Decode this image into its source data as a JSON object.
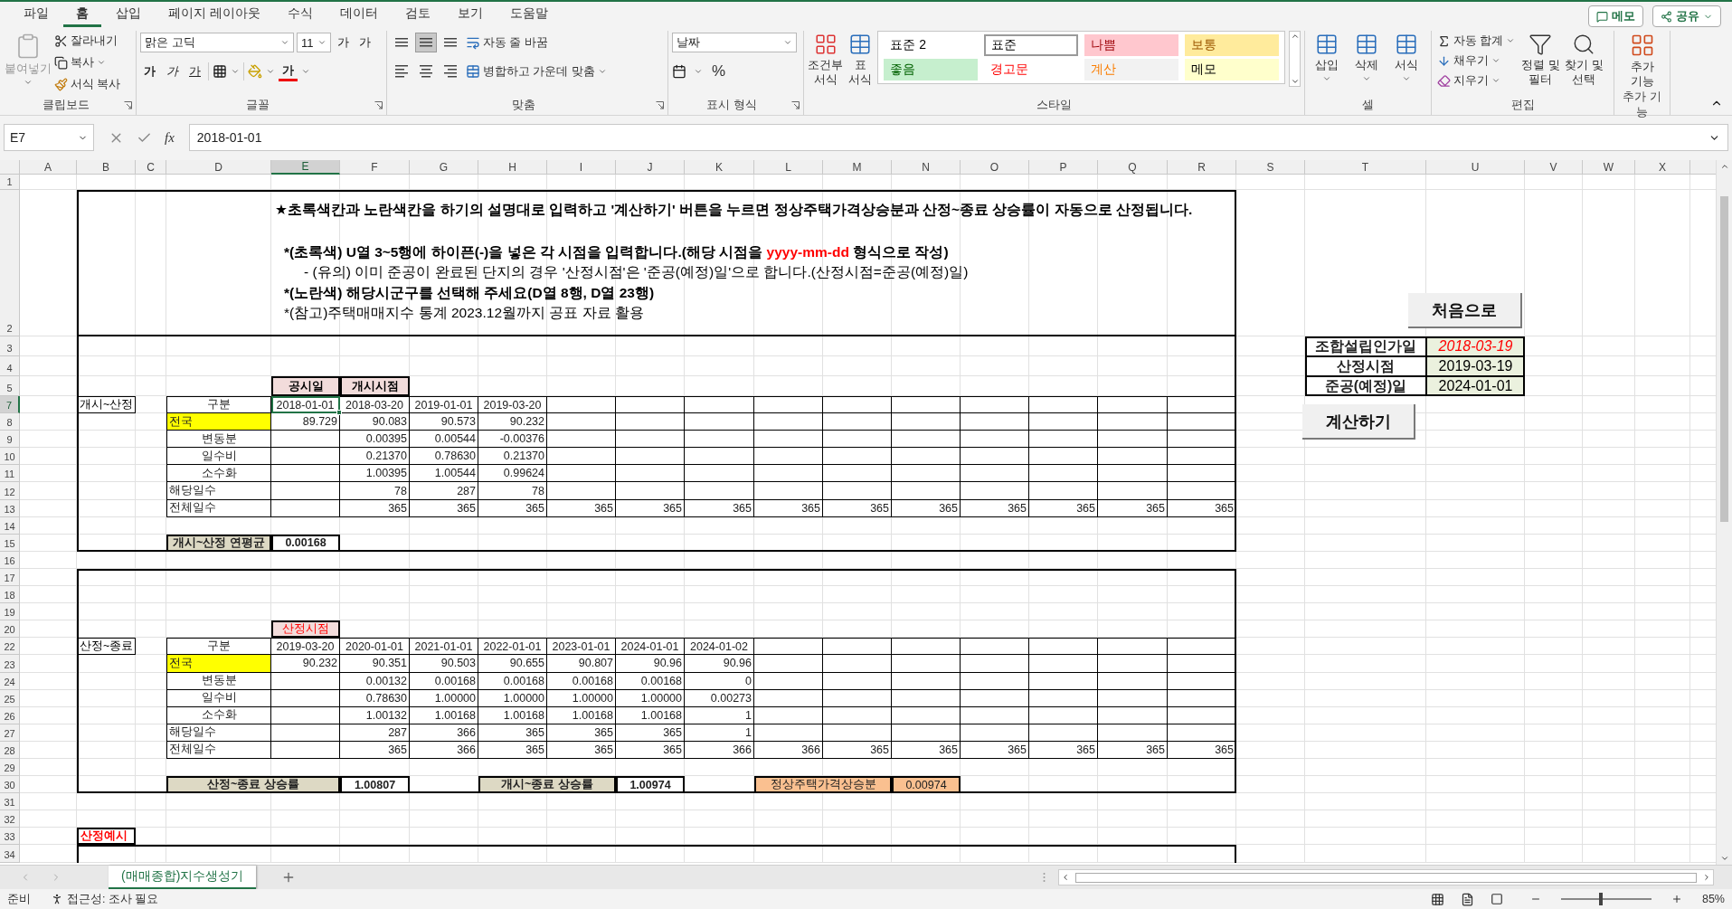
{
  "menu_tabs": [
    {
      "label": "파일",
      "selected": false
    },
    {
      "label": "홈",
      "selected": true
    },
    {
      "label": "삽입",
      "selected": false
    },
    {
      "label": "페이지 레이아웃",
      "selected": false
    },
    {
      "label": "수식",
      "selected": false
    },
    {
      "label": "데이터",
      "selected": false
    },
    {
      "label": "검토",
      "selected": false
    },
    {
      "label": "보기",
      "selected": false
    },
    {
      "label": "도움말",
      "selected": false
    }
  ],
  "top_buttons": [
    {
      "label": "메모",
      "kind": "comment"
    },
    {
      "label": "공유",
      "kind": "share"
    }
  ],
  "ribbon": [
    {
      "kind": "clipboard",
      "label": "클립보드",
      "paste": {
        "label": "붙여넣기",
        "disabled": true
      },
      "actions": [
        "잘라내기",
        "복사",
        "서식 복사"
      ]
    },
    {
      "kind": "font",
      "label": "글꼴",
      "font_name": "맑은 고딕",
      "font_size": "11",
      "size_buttons": [
        "가",
        "가"
      ],
      "format_buttons": [
        "가",
        "가",
        "가"
      ],
      "color_button": "가"
    },
    {
      "kind": "alignment",
      "label": "맞춤",
      "vertical": [
        {
          "selected": false
        },
        {
          "selected": true
        },
        {
          "selected": false
        }
      ],
      "wrap": "자동 줄 바꿈",
      "merge": "병합하고 가운데 맞춤"
    },
    {
      "kind": "number",
      "label": "표시 형식",
      "format": "날짜",
      "percent": "%"
    },
    {
      "kind": "styles",
      "label": "스타일",
      "conditional": "조건부 서식",
      "table_format": "표 서식",
      "styles": [
        {
          "label": "표준 2",
          "color": "#ffffff",
          "kind": "normal",
          "selected": false
        },
        {
          "label": "표준",
          "color": "#ffffff",
          "kind": "normal",
          "selected": true
        },
        {
          "label": "나쁨",
          "color": "#ffc7ce",
          "kind": "bad",
          "selected": false
        },
        {
          "label": "보통",
          "color": "#ffeb9c",
          "kind": "neutral",
          "selected": false
        },
        {
          "label": "좋음",
          "color": "#c6efce",
          "kind": "good",
          "selected": false
        },
        {
          "label": "경고문",
          "color": "#ffffff",
          "kind": "warning",
          "selected": false
        },
        {
          "label": "계산",
          "color": "#f2f2f2",
          "kind": "calculation",
          "selected": false
        },
        {
          "label": "메모",
          "color": "#ffffcc",
          "kind": "note",
          "selected": false
        }
      ]
    },
    {
      "kind": "cells",
      "label": "셀",
      "buttons": [
        "삽입",
        "삭제",
        "서식"
      ]
    },
    {
      "kind": "editing",
      "label": "편집",
      "small": [
        "자동 합계",
        "채우기",
        "지우기"
      ],
      "large": [
        "정렬 및 필터",
        "찾기 및 선택"
      ]
    },
    {
      "kind": "addins",
      "label": "추가 기능",
      "button": "추가 기능"
    }
  ],
  "formula_bar": {
    "name_box": "E7",
    "fx": "fx",
    "value": "2018-01-01"
  },
  "sheet": {
    "columns": [
      {
        "label": "A",
        "selected": false
      },
      {
        "label": "B",
        "selected": false
      },
      {
        "label": "C",
        "selected": false
      },
      {
        "label": "D",
        "selected": false
      },
      {
        "label": "E",
        "selected": true
      },
      {
        "label": "F",
        "selected": false
      },
      {
        "label": "G",
        "selected": false
      },
      {
        "label": "H",
        "selected": false
      },
      {
        "label": "I",
        "selected": false
      },
      {
        "label": "J",
        "selected": false
      },
      {
        "label": "K",
        "selected": false
      },
      {
        "label": "L",
        "selected": false
      },
      {
        "label": "M",
        "selected": false
      },
      {
        "label": "N",
        "selected": false
      },
      {
        "label": "O",
        "selected": false
      },
      {
        "label": "P",
        "selected": false
      },
      {
        "label": "Q",
        "selected": false
      },
      {
        "label": "R",
        "selected": false
      },
      {
        "label": "S",
        "selected": false
      },
      {
        "label": "T",
        "selected": false
      },
      {
        "label": "U",
        "selected": false
      },
      {
        "label": "V",
        "selected": false
      },
      {
        "label": "W",
        "selected": false
      },
      {
        "label": "X",
        "selected": false
      }
    ],
    "rows": [
      {
        "label": "1",
        "selected": false
      },
      {
        "label": "2",
        "selected": false
      },
      {
        "label": "3",
        "selected": false
      },
      {
        "label": "4",
        "selected": false
      },
      {
        "label": "5",
        "selected": false
      },
      {
        "label": "7",
        "selected": true
      },
      {
        "label": "8",
        "selected": false
      },
      {
        "label": "9",
        "selected": false
      },
      {
        "label": "10",
        "selected": false
      },
      {
        "label": "11",
        "selected": false
      },
      {
        "label": "12",
        "selected": false
      },
      {
        "label": "13",
        "selected": false
      },
      {
        "label": "14",
        "selected": false
      },
      {
        "label": "15",
        "selected": false
      },
      {
        "label": "16",
        "selected": false
      },
      {
        "label": "17",
        "selected": false
      },
      {
        "label": "18",
        "selected": false
      },
      {
        "label": "19",
        "selected": false
      },
      {
        "label": "20",
        "selected": false
      },
      {
        "label": "22",
        "selected": false
      },
      {
        "label": "23",
        "selected": false
      },
      {
        "label": "24",
        "selected": false
      },
      {
        "label": "25",
        "selected": false
      },
      {
        "label": "26",
        "selected": false
      },
      {
        "label": "27",
        "selected": false
      },
      {
        "label": "28",
        "selected": false
      },
      {
        "label": "29",
        "selected": false
      },
      {
        "label": "30",
        "selected": false
      },
      {
        "label": "31",
        "selected": false
      },
      {
        "label": "32",
        "selected": false
      },
      {
        "label": "33",
        "selected": false
      },
      {
        "label": "34",
        "selected": false
      }
    ],
    "notice": [
      {
        "kind": "title",
        "parts": [
          {
            "text": "★초록색칸과 노란색칸을 하기의 설명대로 입력하고 '계산하기' 버튼을 누르면 정상주택가격상승분과 산정~종료 상승률이 자동으로 산정됩니다.",
            "highlight": false
          }
        ]
      },
      {
        "kind": "instruction",
        "parts": [
          {
            "text": "*(초록색) U열 3~5행에 하이픈(-)을 넣은 각 시점을 입력합니다.(해당 시점을 ",
            "highlight": false
          },
          {
            "text": "yyyy-mm-dd",
            "highlight": true
          },
          {
            "text": " 형식으로 작성)",
            "highlight": false
          }
        ]
      },
      {
        "kind": "caution",
        "parts": [
          {
            "text": "- (유의) 이미 준공이 완료된 단지의 경우 '산정시점'은 '준공(예정)일'으로 합니다.(산정시점=준공(예정)일)",
            "highlight": false
          }
        ]
      },
      {
        "kind": "instruction",
        "parts": [
          {
            "text": "*(노란색) 해당시군구를 선택해 주세요(D열 8행, D열 23행)",
            "highlight": false
          }
        ]
      },
      {
        "kind": "reference",
        "parts": [
          {
            "text": "*(참고)주택매매지수 통계 2023.12월까지 공표 자료 활용",
            "highlight": false
          }
        ]
      }
    ],
    "sections": [
      {
        "label": "개시~산정",
        "top_headers": [
          {
            "text": "공시일",
            "kind": "date-head"
          },
          {
            "text": "개시시점",
            "kind": "date-head"
          }
        ],
        "table": [
          {
            "kind": "head",
            "label": "구분",
            "values": [
              "2018-01-01",
              "2018-03-20",
              "2019-01-01",
              "2019-03-20"
            ]
          },
          {
            "kind": "region",
            "label": "전국",
            "values": [
              "89.729",
              "90.083",
              "90.573",
              "90.232"
            ]
          },
          {
            "kind": "sub",
            "label": "변동분",
            "values": [
              "0.00395",
              "0.00544",
              "-0.00376"
            ]
          },
          {
            "kind": "sub",
            "label": "일수비",
            "values": [
              "0.21370",
              "0.78630",
              "0.21370"
            ]
          },
          {
            "kind": "sub",
            "label": "소수화",
            "values": [
              "1.00395",
              "1.00544",
              "0.99624"
            ]
          },
          {
            "kind": "plain",
            "label": "해당일수",
            "values": [
              "78",
              "287",
              "78"
            ]
          },
          {
            "kind": "plain",
            "label": "전체일수",
            "values": [
              "365",
              "365",
              "365",
              "365",
              "365",
              "365",
              "365",
              "365",
              "365",
              "365",
              "365",
              "365",
              "365"
            ]
          }
        ],
        "summary": [
          {
            "label": "개시~산정 연평균",
            "value": "0.00168",
            "kind": "rate"
          }
        ]
      },
      {
        "label": "산정~종료",
        "top_headers": [
          {
            "text": "산정시점",
            "kind": "alert-head"
          }
        ],
        "table": [
          {
            "kind": "head",
            "label": "구분",
            "values": [
              "2019-03-20",
              "2020-01-01",
              "2021-01-01",
              "2022-01-01",
              "2023-01-01",
              "2024-01-01",
              "2024-01-02"
            ]
          },
          {
            "kind": "region",
            "label": "전국",
            "values": [
              "90.232",
              "90.351",
              "90.503",
              "90.655",
              "90.807",
              "90.96",
              "90.96"
            ]
          },
          {
            "kind": "sub",
            "label": "변동분",
            "values": [
              "0.00132",
              "0.00168",
              "0.00168",
              "0.00168",
              "0.00168",
              "0"
            ]
          },
          {
            "kind": "sub",
            "label": "일수비",
            "values": [
              "0.78630",
              "1.00000",
              "1.00000",
              "1.00000",
              "1.00000",
              "0.00273"
            ]
          },
          {
            "kind": "sub",
            "label": "소수화",
            "values": [
              "1.00132",
              "1.00168",
              "1.00168",
              "1.00168",
              "1.00168",
              "1"
            ]
          },
          {
            "kind": "plain",
            "label": "해당일수",
            "values": [
              "287",
              "366",
              "365",
              "365",
              "365",
              "1"
            ]
          },
          {
            "kind": "plain",
            "label": "전체일수",
            "values": [
              "365",
              "366",
              "365",
              "365",
              "365",
              "366",
              "366",
              "365",
              "365",
              "365",
              "365",
              "365",
              "365"
            ]
          }
        ],
        "summary": [
          {
            "label": "산정~종료 상승률",
            "value": "1.00807",
            "kind": "rate"
          },
          {
            "label": "개시~종료 상승률",
            "value": "1.00974",
            "kind": "rate"
          },
          {
            "label": "정상주택가격상승분",
            "value": "0.00974",
            "kind": "result"
          }
        ]
      }
    ],
    "example_label": "산정예시",
    "key_dates": [
      {
        "label": "조합설립인가일",
        "value": "2018-03-19",
        "emphasis": true
      },
      {
        "label": "산정시점",
        "value": "2019-03-19",
        "emphasis": false
      },
      {
        "label": "준공(예정)일",
        "value": "2024-01-01",
        "emphasis": false
      }
    ],
    "buttons": [
      "처음으로",
      "계산하기"
    ]
  },
  "sheet_tabs": [
    {
      "label": "(매매종합)지수생성기",
      "selected": true
    }
  ],
  "status_bar": {
    "ready": "준비",
    "accessibility": "접근성: 조사 필요",
    "zoom": "85%",
    "zoom_slider": {
      "level": 0.42
    }
  }
}
